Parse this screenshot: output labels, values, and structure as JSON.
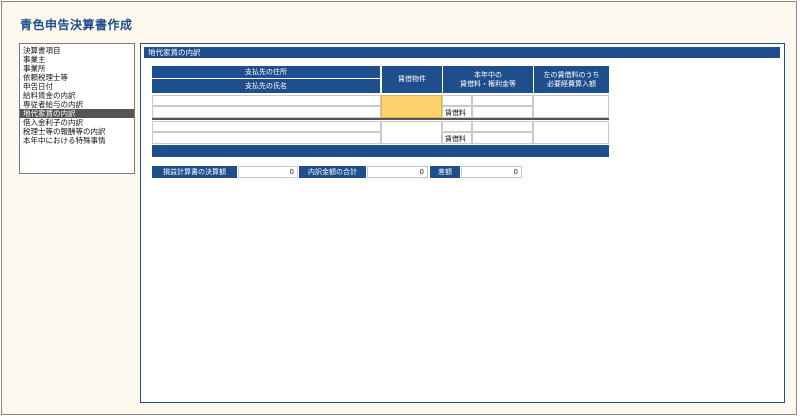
{
  "app": {
    "title": "青色申告決算書作成"
  },
  "sidebar": {
    "items": [
      {
        "label": "決算書項目"
      },
      {
        "label": "事業主"
      },
      {
        "label": "事業所"
      },
      {
        "label": "依頼税理士等"
      },
      {
        "label": "申告日付"
      },
      {
        "label": "給料賃金の内訳"
      },
      {
        "label": "専従者給与の内訳"
      },
      {
        "label": "地代家賃の内訳"
      },
      {
        "label": "借入金利子の内訳"
      },
      {
        "label": "税理士等の報酬等の内訳"
      },
      {
        "label": "本年中における特殊事情"
      }
    ],
    "selected_index": 7
  },
  "main": {
    "section_title": "地代家賃の内訳",
    "table": {
      "col_payee_address": "支払先の住所",
      "col_payee_name": "支払先の氏名",
      "col_property": "賃借物件",
      "col_amount": "本年中の\n賃借料・権利金等",
      "col_expense": "左の賃借料のうち\n必要経費算入額",
      "row_label_rent": "賃借料"
    },
    "summary": {
      "pl_label": "損益計算書の決算額",
      "pl_value": "0",
      "total_label": "内訳金額の合計",
      "total_value": "0",
      "diff_label": "差額",
      "diff_value": "0"
    }
  }
}
